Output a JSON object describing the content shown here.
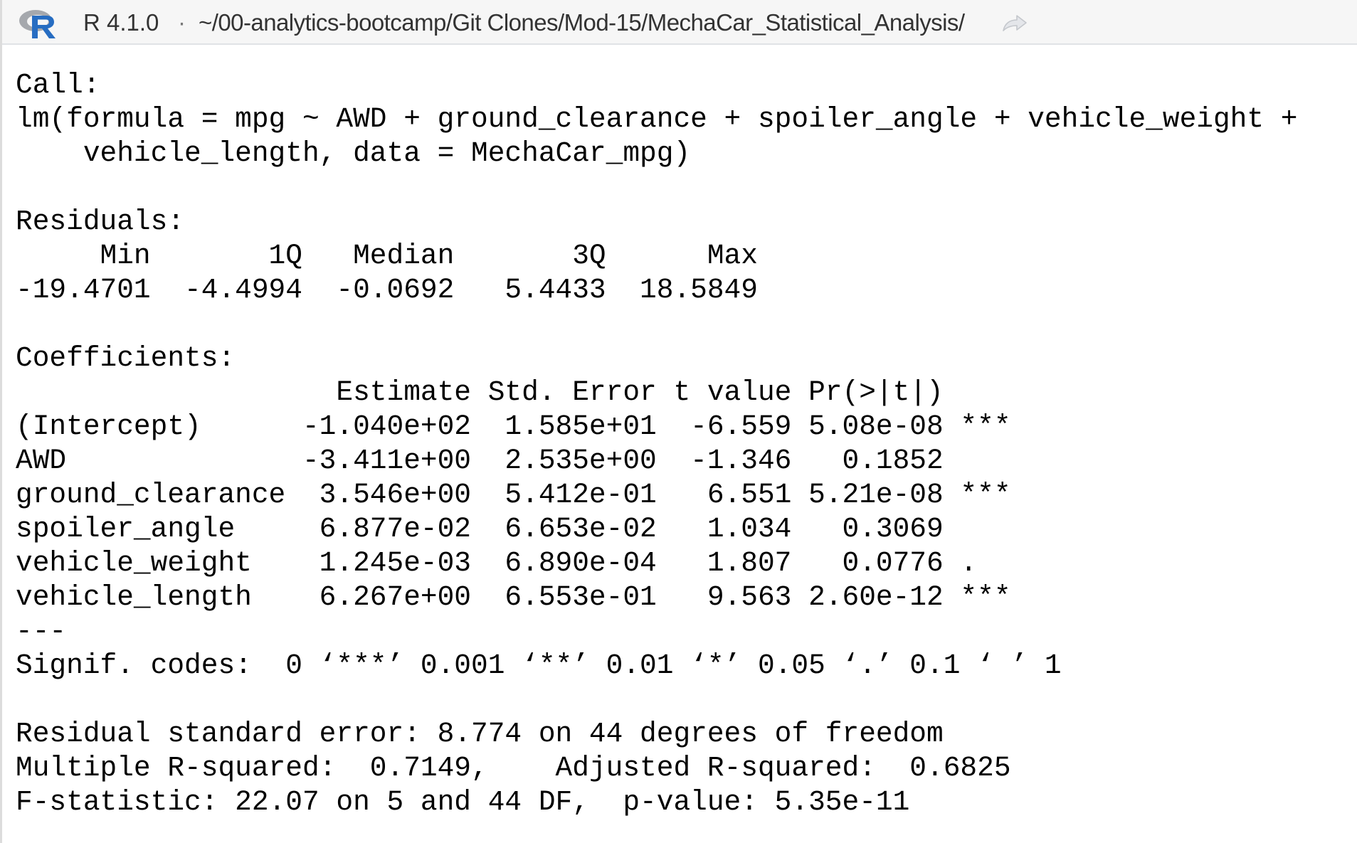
{
  "header": {
    "r_version": "R 4.1.0",
    "separator": "·",
    "working_directory": "~/00-analytics-bootcamp/Git Clones/Mod-15/MechaCar_Statistical_Analysis/",
    "logo_icon": "r-logo-icon",
    "goto_icon": "goto-directory-icon"
  },
  "console": {
    "lines": [
      "Call:",
      "lm(formula = mpg ~ AWD + ground_clearance + spoiler_angle + vehicle_weight +",
      "    vehicle_length, data = MechaCar_mpg)",
      "",
      "Residuals:",
      "     Min       1Q   Median       3Q      Max ",
      "-19.4701  -4.4994  -0.0692   5.4433  18.5849 ",
      "",
      "Coefficients:",
      "                   Estimate Std. Error t value Pr(>|t|)    ",
      "(Intercept)      -1.040e+02  1.585e+01  -6.559 5.08e-08 ***",
      "AWD              -3.411e+00  2.535e+00  -1.346   0.1852    ",
      "ground_clearance  3.546e+00  5.412e-01   6.551 5.21e-08 ***",
      "spoiler_angle     6.877e-02  6.653e-02   1.034   0.3069    ",
      "vehicle_weight    1.245e-03  6.890e-04   1.807   0.0776 .  ",
      "vehicle_length    6.267e+00  6.553e-01   9.563 2.60e-12 ***",
      "---",
      "Signif. codes:  0 ‘***’ 0.001 ‘**’ 0.01 ‘*’ 0.05 ‘.’ 0.1 ‘ ’ 1",
      "",
      "Residual standard error: 8.774 on 44 degrees of freedom",
      "Multiple R-squared:  0.7149,\tAdjusted R-squared:  0.6825 ",
      "F-statistic: 22.07 on 5 and 44 DF,  p-value: 5.35e-11"
    ]
  },
  "colors": {
    "header_bg": "#f6f6f6",
    "header_border": "#e0e3e6",
    "r_logo_ring": "#a5a8ad",
    "r_logo_letter": "#276dc2",
    "console_text": "#000000"
  }
}
